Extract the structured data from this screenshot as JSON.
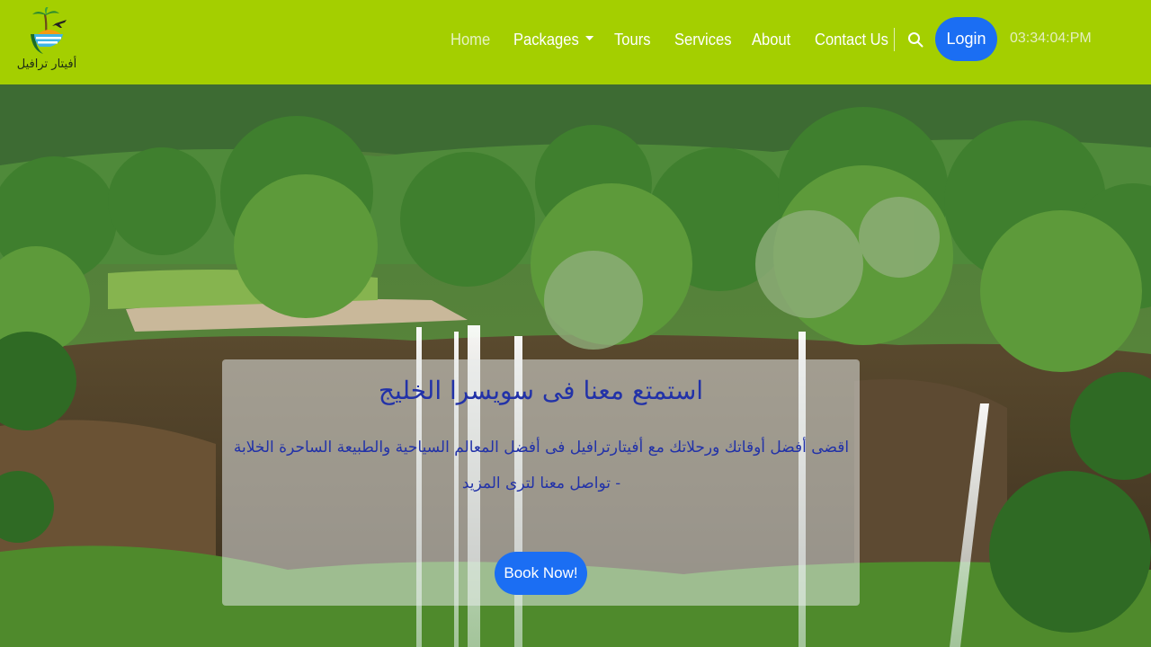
{
  "brand": {
    "logo_text": "أفيتار ترافيل"
  },
  "nav": {
    "items": [
      {
        "label": "Home",
        "active": true
      },
      {
        "label": "Packages",
        "dropdown": true
      },
      {
        "label": "Tours"
      },
      {
        "label": "Services"
      },
      {
        "label": "About"
      },
      {
        "label": "Contact Us"
      }
    ],
    "search_icon": "search-icon",
    "login_label": "Login",
    "clock": "03:34:04:PM"
  },
  "hero": {
    "title": "استمتع معنا فى سويسرا الخليج",
    "description": "اقضى أفضل أوقاتك ورحلاتك مع أفيتارترافيل فى أفضل المعالم السياحية والطبيعة الساحرة الخلابة - تواصل معنا لترى المزيد",
    "button_label": "Book Now!"
  },
  "colors": {
    "header_bg": "#a4cf00",
    "button_bg": "#1b6ef3",
    "hero_text": "#2232a8"
  }
}
